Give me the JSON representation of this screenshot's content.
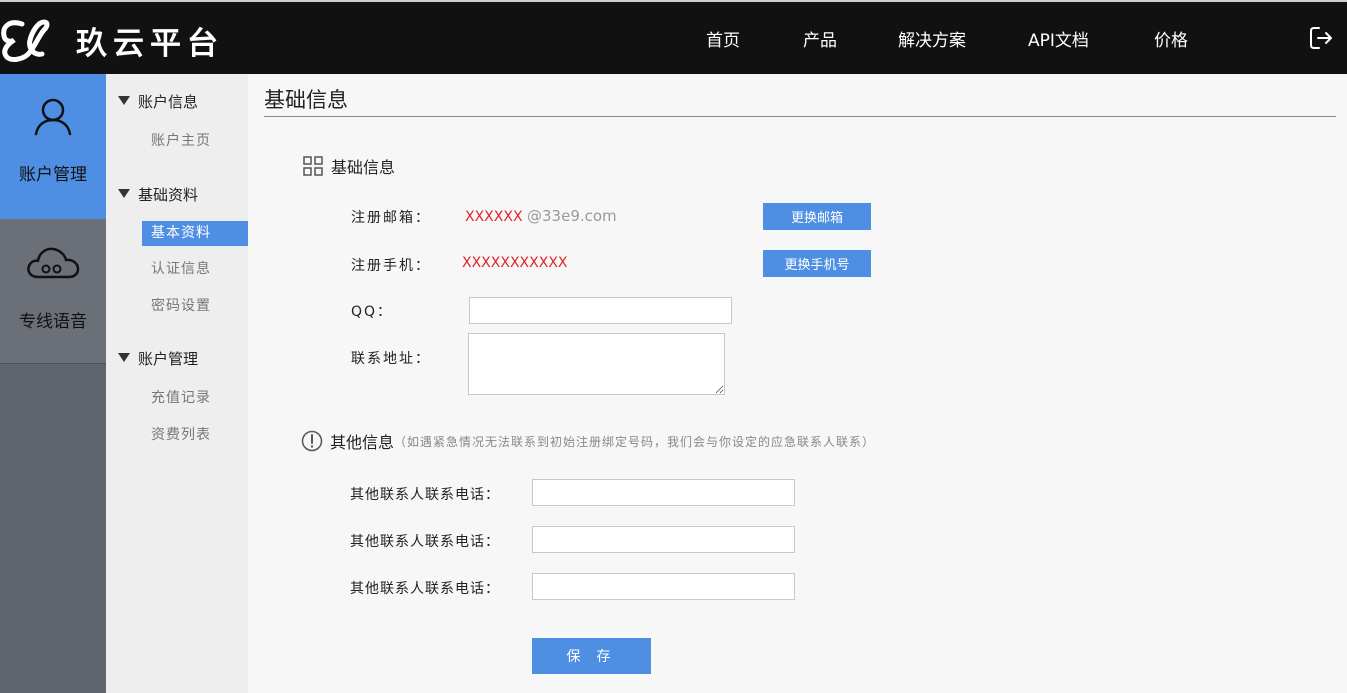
{
  "header": {
    "brand": "玖云平台",
    "nav": [
      "首页",
      "产品",
      "解决方案",
      "API文档",
      "价格"
    ]
  },
  "rail": [
    {
      "label": "账户管理",
      "icon": "user-icon"
    },
    {
      "label": "专线语音",
      "icon": "cloud-icon"
    }
  ],
  "submenu": {
    "groups": [
      {
        "title": "账户信息",
        "items": [
          "账户主页"
        ]
      },
      {
        "title": "基础资料",
        "items": [
          "基本资料",
          "认证信息",
          "密码设置"
        ]
      },
      {
        "title": "账户管理",
        "items": [
          "充值记录",
          "资费列表"
        ]
      }
    ]
  },
  "main": {
    "title": "基础信息",
    "basic": {
      "heading": "基础信息",
      "email_label": "注册邮箱：",
      "email_masked": "XXXXXX",
      "email_domain": "@33e9.com",
      "change_email": "更换邮箱",
      "phone_label": "注册手机：",
      "phone_value": "XXXXXXXXXXX",
      "change_phone": "更换手机号",
      "qq_label": "QQ：",
      "address_label": "联系地址："
    },
    "other": {
      "heading": "其他信息",
      "note": "（如遇紧急情况无法联系到初始注册绑定号码，我们会与你设定的应急联系人联系）",
      "contact_label": "其他联系人联系电话："
    },
    "save": "保 存"
  },
  "colors": {
    "accent": "#4f8fe3",
    "header": "#111111",
    "rail": "#5f656d",
    "masked": "#e0242b"
  }
}
